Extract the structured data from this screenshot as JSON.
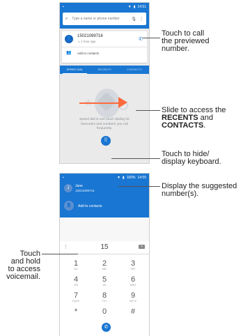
{
  "phone1": {
    "status_time": "14:51",
    "search_placeholder": "Type a name or phone number",
    "recent_number": "15021099716",
    "recent_time": "1 hour ago",
    "add_contacts": "Add to contacts",
    "tabs": [
      "SPEED DIAL",
      "RECENTS",
      "CONTACTS"
    ],
    "speed_dial_text": "Speed dial is one touch dialing for favourites and numbers you call frequently."
  },
  "phone2": {
    "status_battery": "100%",
    "status_time": "14:55",
    "suggest_name": "Jane",
    "suggest_number": "15021099716",
    "add_contacts": "Add to contacts",
    "dialed_digits": "15",
    "keys": [
      {
        "digit": "1",
        "letters": "GO"
      },
      {
        "digit": "2",
        "letters": "ABC"
      },
      {
        "digit": "3",
        "letters": "DEF"
      },
      {
        "digit": "4",
        "letters": "GHI"
      },
      {
        "digit": "5",
        "letters": "JKL"
      },
      {
        "digit": "6",
        "letters": "MNO"
      },
      {
        "digit": "7",
        "letters": "PQRS"
      },
      {
        "digit": "8",
        "letters": "TUV"
      },
      {
        "digit": "9",
        "letters": "WXYZ"
      },
      {
        "digit": "*",
        "letters": ""
      },
      {
        "digit": "0",
        "letters": "+"
      },
      {
        "digit": "#",
        "letters": ""
      }
    ]
  },
  "callouts": {
    "call_line1": "Touch to call",
    "call_line2": "the previewed",
    "call_line3": "number.",
    "slide_line1": "Slide to access the",
    "slide_recents": "RECENTS",
    "slide_and": " and",
    "slide_contacts": "CONTACTS",
    "slide_period": ".",
    "hide_line1": "Touch to hide/",
    "hide_line2": "display keyboard.",
    "suggest_line1": "Display the suggested",
    "suggest_line2": "number(s).",
    "voicemail_line1": "Touch",
    "voicemail_line2": "and hold",
    "voicemail_line3": "to access",
    "voicemail_line4": "voicemail."
  },
  "colors": {
    "primary": "#1976d2",
    "swipe_arrow": "#ff6a3d"
  }
}
